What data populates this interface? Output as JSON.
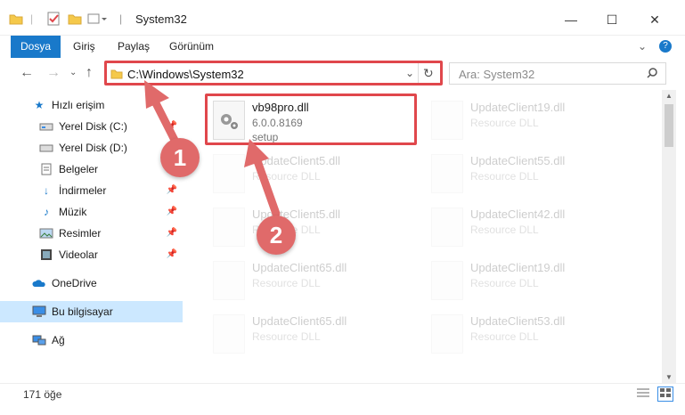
{
  "window": {
    "title": "System32",
    "controls": {
      "minimize": "—",
      "maximize": "☐",
      "close": "✕"
    }
  },
  "ribbon": {
    "tabs": [
      {
        "label": "Dosya",
        "active": true
      },
      {
        "label": "Giriş"
      },
      {
        "label": "Paylaş"
      },
      {
        "label": "Görünüm"
      }
    ]
  },
  "address": {
    "path": "C:\\Windows\\System32",
    "search_placeholder": "Ara: System32"
  },
  "sidebar": {
    "items": [
      {
        "label": "Hızlı erişim",
        "icon": "star-icon"
      },
      {
        "label": "Yerel Disk (C:)",
        "icon": "drive-icon",
        "pinned": true
      },
      {
        "label": "Yerel Disk (D:)",
        "icon": "drive-icon"
      },
      {
        "label": "Belgeler",
        "icon": "document-icon",
        "pinned": true
      },
      {
        "label": "İndirmeler",
        "icon": "download-icon",
        "pinned": true
      },
      {
        "label": "Müzik",
        "icon": "music-icon",
        "pinned": true
      },
      {
        "label": "Resimler",
        "icon": "picture-icon",
        "pinned": true
      },
      {
        "label": "Videolar",
        "icon": "video-icon",
        "pinned": true
      },
      {
        "label": "OneDrive",
        "icon": "cloud-icon"
      },
      {
        "label": "Bu bilgisayar",
        "icon": "computer-icon",
        "selected": true
      },
      {
        "label": "Ağ",
        "icon": "network-icon"
      }
    ]
  },
  "files": {
    "highlighted": {
      "name": "vb98pro.dll",
      "version": "6.0.0.8169",
      "desc": "setup"
    },
    "left_column": [
      {
        "name": "UpdateClient5.dll",
        "desc": "Resource DLL"
      },
      {
        "name": "UpdateClient5.dll",
        "desc": "Resource DLL"
      },
      {
        "name": "UpdateClient65.dll",
        "desc": "Resource DLL"
      },
      {
        "name": "UpdateClient65.dll",
        "desc": "Resource DLL"
      }
    ],
    "right_column": [
      {
        "name": "UpdateClient19.dll",
        "desc": "Resource DLL"
      },
      {
        "name": "UpdateClient55.dll",
        "desc": "Resource DLL"
      },
      {
        "name": "UpdateClient42.dll",
        "desc": "Resource DLL"
      },
      {
        "name": "UpdateClient19.dll",
        "desc": "Resource DLL"
      },
      {
        "name": "UpdateClient53.dll",
        "desc": "Resource DLL"
      }
    ]
  },
  "status": {
    "count": "171 öğe"
  },
  "annotations": {
    "step1": "1",
    "step2": "2",
    "color": "#e0474c"
  }
}
